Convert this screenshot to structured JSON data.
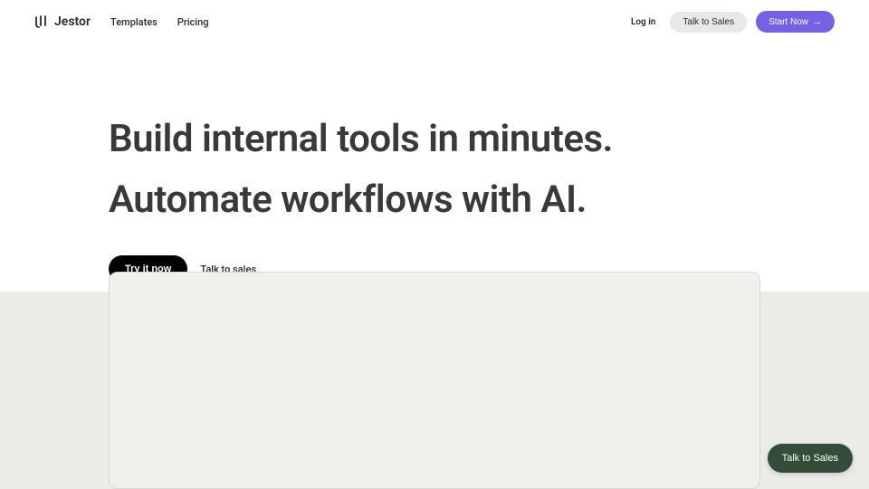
{
  "header": {
    "brand": "Jestor",
    "nav": {
      "templates": "Templates",
      "pricing": "Pricing"
    },
    "login": "Log in",
    "talk_to_sales": "Talk to Sales",
    "start_now": "Start Now"
  },
  "hero": {
    "title_line1": "Build internal tools in minutes.",
    "title_line2": "Automate workflows with AI.",
    "try_now": "Try it now",
    "talk_to_sales": "Talk to sales"
  },
  "floating": {
    "talk_to_sales": "Talk to Sales"
  }
}
